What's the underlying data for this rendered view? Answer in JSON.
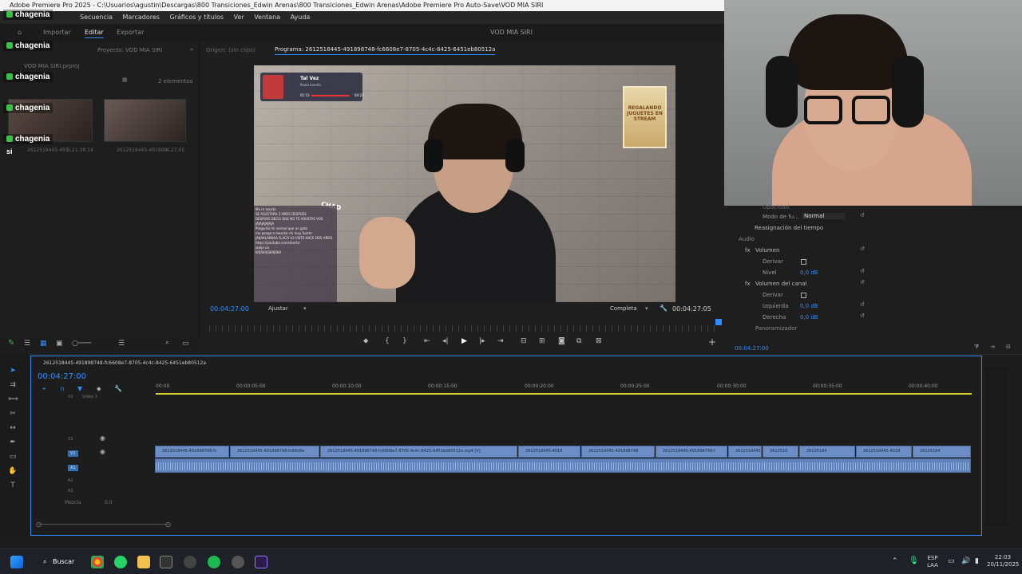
{
  "window": {
    "title": "Adobe Premiere Pro 2025 - C:\\Usuarios\\agustin\\Descargas\\800 Transiciones_Edwin Arenas\\800 Transiciones_Edwin Arenas\\Adobe Premiere Pro Auto-Save\\VOD MIA SIRI"
  },
  "menu": [
    "Secuencia",
    "Marcadores",
    "Gráficos y títulos",
    "Ver",
    "Ventana",
    "Ayuda"
  ],
  "workspace_tabs": {
    "import": "Importar",
    "edit": "Editar",
    "export": "Exportar"
  },
  "project_name": "VOD MIA SIRI",
  "project_panel": {
    "tab": "Proyecto: VOD MIA SIRI",
    "file": "VOD MIA SIRI.prproj",
    "items_count": "2 elementos",
    "clips": [
      {
        "name": "2612518445-491...",
        "duration": "5:21:38:14"
      },
      {
        "name": "2612518445-491898...",
        "duration": "4:27:05"
      }
    ]
  },
  "chat_overlay": {
    "user": "chagenia",
    "extra_text": "si"
  },
  "monitor": {
    "origin_tab": "Origen: (sin clips)",
    "program_tab": "Programa: 2612518445-491898748-fc6608e7-8705-4c4c-8425-6451eb80512a",
    "current_time": "00:04:27:00",
    "fit": "Ajustar",
    "quality": "Completa",
    "duration": "00:04:27:05"
  },
  "video_overlay": {
    "song_title": "Tal Vez",
    "song_artist": "Paulo Londra",
    "song_time_start": "01:13",
    "song_time_end": "04:23",
    "poster_text": "REGALANDO JUGUETES EN STREAM",
    "chad_label": "CHAD",
    "chat_lines": [
      "Me re asusto",
      "SE ASUSTARA 3 AÑOS DESPUES",
      "DESPUES DECIS QUE NO TE ASUSTAS VOS",
      "JAJAJAJAJAJA",
      "Pregunta mi normal que un gato",
      "me pongo a mezclar mi muy fuerte",
      "JAKAKLAKKAA FLACO LO VISTE HACE DOS AÑOS",
      "https://youtube.com/shorts/",
      "jajaja ua",
      "KAJSKAJSKAJSKA"
    ]
  },
  "effects_panel": {
    "opacity_label": "Opacidad",
    "blend_mode_label": "Modo de fu...",
    "blend_mode_value": "Normal",
    "time_remap": "Reasignación del tiempo",
    "audio_label": "Audio",
    "volume": "Volumen",
    "bypass": "Derivar",
    "level": "Nivel",
    "level_value": "0,0 dB",
    "channel_volume": "Volumen del canal",
    "left": "Izquierda",
    "left_value": "0,0 dB",
    "right": "Derecha",
    "right_value": "0,0 dB",
    "panner": "Panoramizador",
    "time": "00:04:27:00"
  },
  "timeline": {
    "sequence_tab": "2612518445-491898748-fc6608e7-8705-4c4c-8425-6451eb80512a",
    "current_time": "00:04:27:00",
    "ruler": [
      "00:00",
      "00:00:05:00",
      "00:00:10:00",
      "00:00:15:00",
      "00:00:20:00",
      "00:00:25:00",
      "00:00:30:00",
      "00:00:35:00",
      "00:00:40:00"
    ],
    "tracks": [
      "V3",
      "V2",
      "V1",
      "A1",
      "A2",
      "A3"
    ],
    "v3_label": "Vídeo 3",
    "mix_label": "Mezcla",
    "mix_value": "0,0",
    "clips": [
      "2612518445-491898748-fc",
      "2612518445-491898748-fc6608e",
      "2612518445-491898748-fc6608e7-8705-4c4c-8425-6451eb80512a.mp4 [V]",
      "2612518445-4918",
      "2612518445-491898748-",
      "2612518445-491898748-f",
      "2612518445",
      "2612518",
      "26125184",
      "2612518445-4918",
      "26125184"
    ]
  },
  "taskbar": {
    "search": "Buscar",
    "lang_top": "ESP",
    "lang_bottom": "LAA",
    "time": "22:03",
    "date": "20/11/2025"
  }
}
